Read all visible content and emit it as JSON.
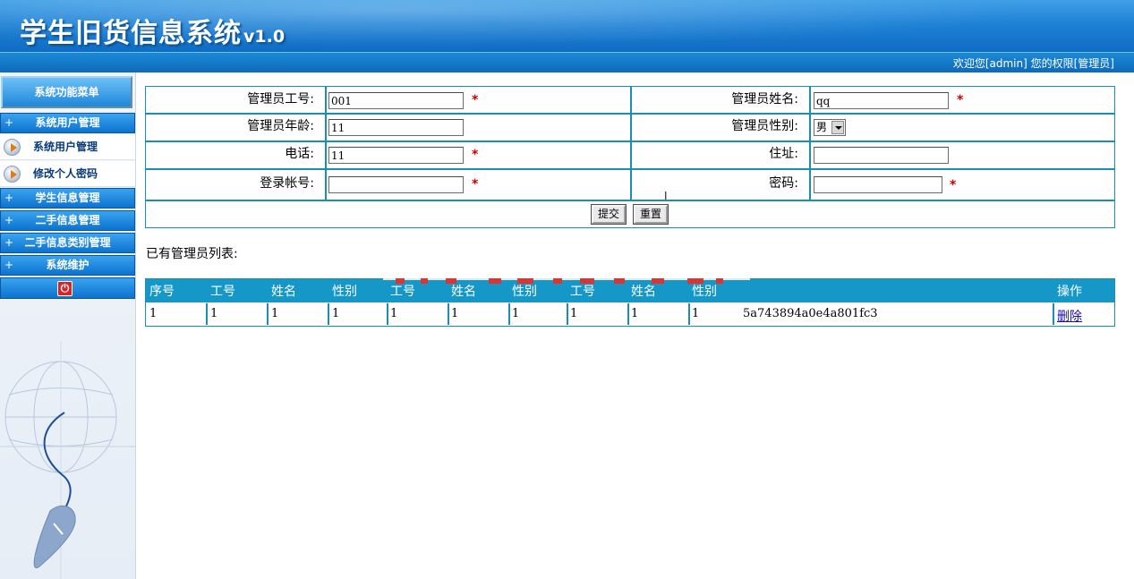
{
  "header": {
    "title": "学生旧货信息系统",
    "version": "v1.0",
    "welcome": "欢迎您[admin] 您的权限[管理员]"
  },
  "sidebar": {
    "menu_title": "系统功能菜单",
    "groups": [
      {
        "label": "系统用户管理",
        "toggle": "+"
      },
      {
        "label": "学生信息管理",
        "toggle": "+"
      },
      {
        "label": "二手信息管理",
        "toggle": "+"
      },
      {
        "label": "二手信息类别管理",
        "toggle": "+"
      },
      {
        "label": "系统维护",
        "toggle": "+"
      }
    ],
    "sub_items": [
      {
        "label": "系统用户管理"
      },
      {
        "label": "修改个人密码"
      }
    ]
  },
  "form": {
    "id_label": "管理员工号:",
    "id_value": "001",
    "name_label": "管理员姓名:",
    "name_value": "qq",
    "age_label": "管理员年龄:",
    "age_value": "11",
    "sex_label": "管理员性别:",
    "sex_value": "男",
    "phone_label": "电话:",
    "phone_value": "11",
    "address_label": "住址:",
    "address_value": "",
    "account_label": "登录帐号:",
    "account_value": "",
    "password_label": "密码:",
    "password_value": "",
    "required_mark": "*",
    "submit_label": "提交",
    "reset_label": "重置"
  },
  "list": {
    "caption": "已有管理员列表:",
    "headers": [
      "序号",
      "工号",
      "姓名",
      "性别",
      "工号",
      "姓名",
      "性别",
      "工号",
      "姓名",
      "性别",
      "操作"
    ],
    "rows": [
      {
        "cells": [
          "1",
          "1",
          "1",
          "1",
          "1",
          "1",
          "1",
          "1",
          "1",
          "1"
        ],
        "hash": "5a743894a0e4a801fc3",
        "action": "删除"
      }
    ]
  },
  "colors": {
    "banner": "#1f82d6",
    "grid": "#1a8fae",
    "table_header": "#1598c8",
    "required": "#cc0000"
  }
}
